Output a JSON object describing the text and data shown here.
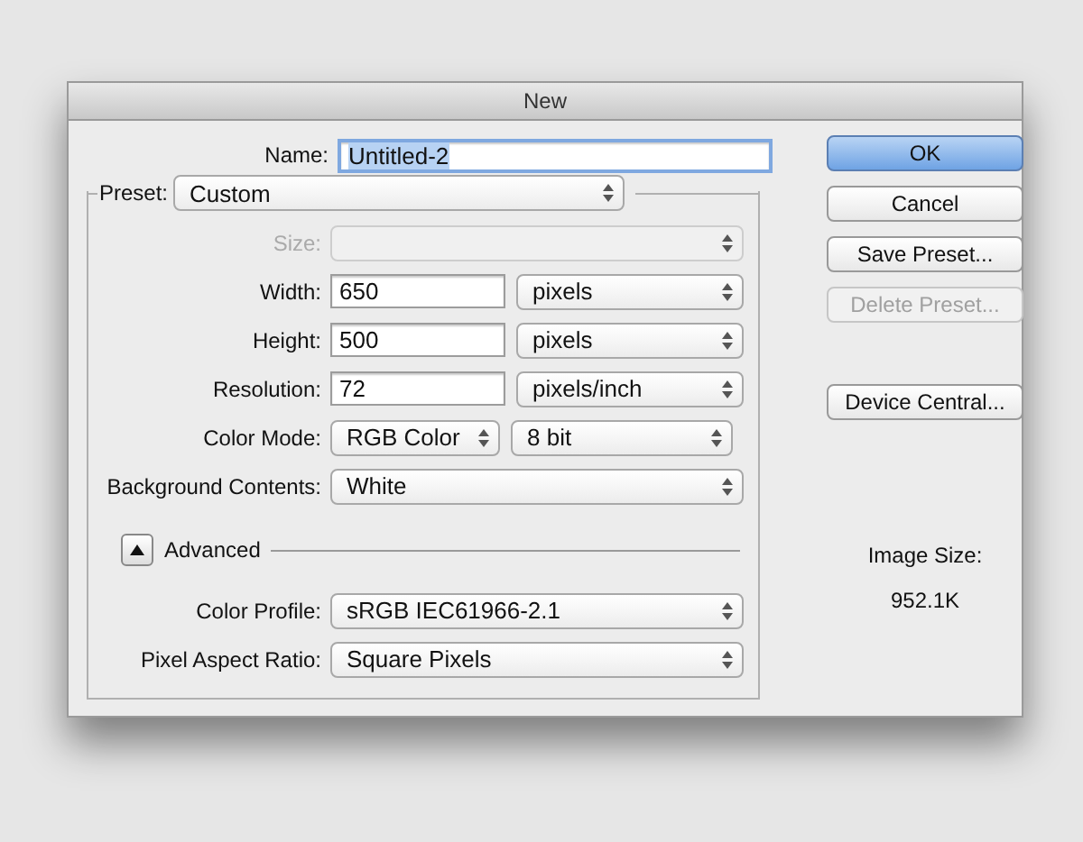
{
  "window": {
    "title": "New"
  },
  "name_field": {
    "label": "Name:",
    "value": "Untitled-2",
    "text_selected": true
  },
  "preset": {
    "label": "Preset:",
    "value": "Custom"
  },
  "rows": [
    {
      "kind": "select",
      "label": "Size:",
      "disabled": true
    },
    {
      "kind": "input",
      "label": "Width:",
      "value": "650",
      "unit": "pixels",
      "disabled": false
    },
    {
      "kind": "input",
      "label": "Height:",
      "value": "500",
      "unit": "pixels",
      "disabled": false
    },
    {
      "kind": "input",
      "label": "Resolution:",
      "value": "72",
      "unit": "pixels/inch",
      "disabled": false
    },
    {
      "kind": "pair",
      "label": "Color Mode:",
      "value": "RGB Color",
      "unit": "8 bit",
      "disabled": false
    },
    {
      "kind": "select",
      "label": "Background Contents:",
      "value": "White",
      "disabled": false
    }
  ],
  "advanced": {
    "label": "Advanced",
    "expanded": true,
    "rows": [
      {
        "kind": "select",
        "label": "Color Profile:",
        "value": "sRGB IEC61966-2.1",
        "disabled": false
      },
      {
        "kind": "select",
        "label": "Pixel Aspect Ratio:",
        "value": "Square Pixels",
        "disabled": false
      }
    ]
  },
  "buttons": [
    {
      "kind": "default",
      "label": "OK",
      "disabled": false
    },
    {
      "kind": "normal",
      "label": "Cancel",
      "disabled": false
    },
    {
      "kind": "normal",
      "label": "Save Preset...",
      "disabled": false
    },
    {
      "kind": "normal",
      "label": "Delete Preset...",
      "disabled": true
    },
    {
      "kind": "gap"
    },
    {
      "kind": "normal",
      "label": "Device Central...",
      "disabled": false
    }
  ],
  "image_size": {
    "label": "Image Size:",
    "value": "952.1K"
  }
}
